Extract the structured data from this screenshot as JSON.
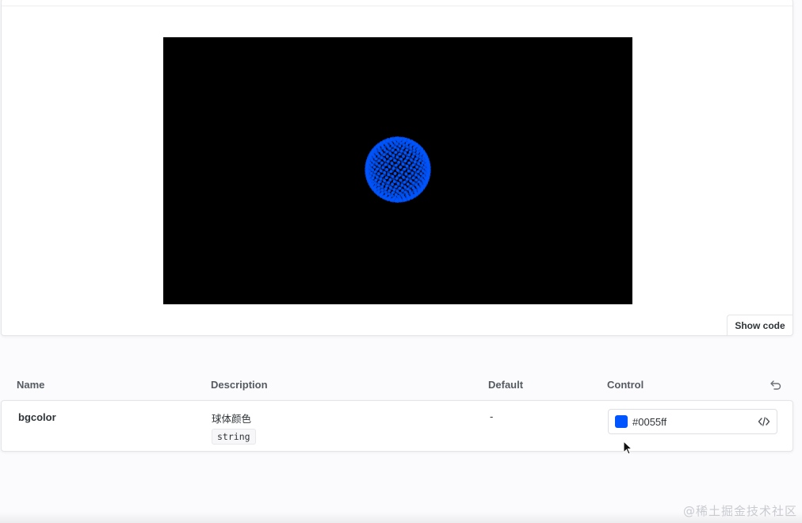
{
  "preview": {
    "show_code_label": "Show code",
    "sphere_color": "#0055ff",
    "stage_background": "#000000"
  },
  "args_table": {
    "headers": {
      "name": "Name",
      "description": "Description",
      "default": "Default",
      "control": "Control"
    },
    "rows": [
      {
        "name": "bgcolor",
        "description": "球体颜色",
        "type": "string",
        "default": "-",
        "control_value": "#0055ff",
        "swatch_color": "#0055ff"
      }
    ]
  },
  "watermark": "@稀土掘金技术社区",
  "icons": {
    "reset": "reset-icon",
    "code": "code-icon",
    "cursor": "mouse-cursor-icon"
  }
}
